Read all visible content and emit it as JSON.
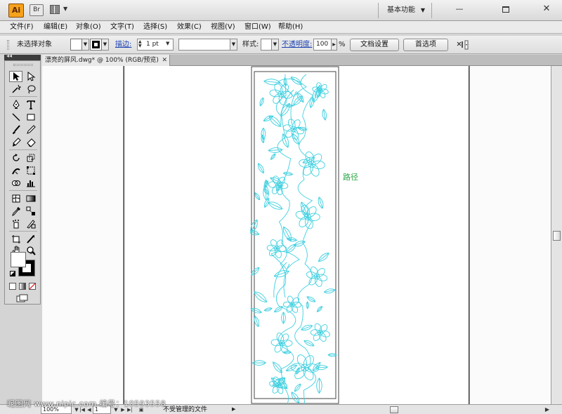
{
  "app": {
    "logo_text": "Ai",
    "bridge_label": "Br"
  },
  "workspace": {
    "label": "基本功能"
  },
  "window_controls": {
    "minimize": "—",
    "close": "✕"
  },
  "menu": {
    "items": [
      {
        "label": "文件(F)"
      },
      {
        "label": "编辑(E)"
      },
      {
        "label": "对象(O)"
      },
      {
        "label": "文字(T)"
      },
      {
        "label": "选择(S)"
      },
      {
        "label": "效果(C)"
      },
      {
        "label": "视图(V)"
      },
      {
        "label": "窗口(W)"
      },
      {
        "label": "帮助(H)"
      }
    ]
  },
  "control_bar": {
    "selection_label": "未选择对象",
    "stroke_label": "描边:",
    "stroke_weight": "1 pt",
    "style_label": "样式:",
    "opacity_label": "不透明度:",
    "opacity_value": "100",
    "opacity_unit": "%",
    "document_setup_button": "文档设置",
    "preferences_button": "首选项"
  },
  "tools_header": {
    "collapse_glyph": "◂◂"
  },
  "document_tab": {
    "title": "漂亮的屏风.dwg* @ 100% (RGB/预览)",
    "close_glyph": "✕"
  },
  "canvas": {
    "path_hint": "路径",
    "artwork_color": "#3fd0e0"
  },
  "status_bar": {
    "zoom": "100%",
    "artboard_number": "1",
    "status_text": "不受管理的文件"
  },
  "watermark": {
    "text": "昵图网 www.nipic.com  编号：10593558"
  }
}
